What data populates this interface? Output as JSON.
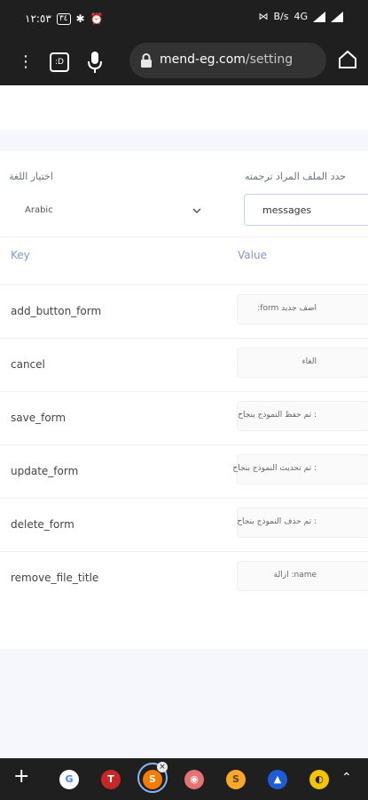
{
  "status_bar": {
    "time": "١٢:٥٣",
    "battery": "٣٤",
    "network": "4G",
    "speed": "B/s"
  },
  "browser": {
    "tab_count": ":D",
    "url_domain": "mend-eg.com",
    "url_path": "/setting"
  },
  "form": {
    "language_label": "اختيار اللغة",
    "language_value": "Arabic",
    "file_label": "حدد الملف المراد ترجمته",
    "file_value": "messages"
  },
  "table": {
    "headers": [
      "Key",
      "Value"
    ],
    "rows": [
      {
        "key": "add_button_form",
        "value": ":form اضف جديد"
      },
      {
        "key": "cancel",
        "value": "الغاء"
      },
      {
        "key": "save_form",
        "value": "تم حفظ النموذج بنجاح :"
      },
      {
        "key": "update_form",
        "value": "تم تحديث النموذج بنجاح :"
      },
      {
        "key": "delete_form",
        "value": "تم حذف النموذج بنجاح :"
      },
      {
        "key": "remove_file_title",
        "value": "ازالة :name"
      }
    ]
  },
  "taskbar": {
    "apps": [
      "google",
      "app-red",
      "app-orange-active",
      "app-pink",
      "app-yellow",
      "app-blue",
      "app-yellow-2"
    ]
  }
}
